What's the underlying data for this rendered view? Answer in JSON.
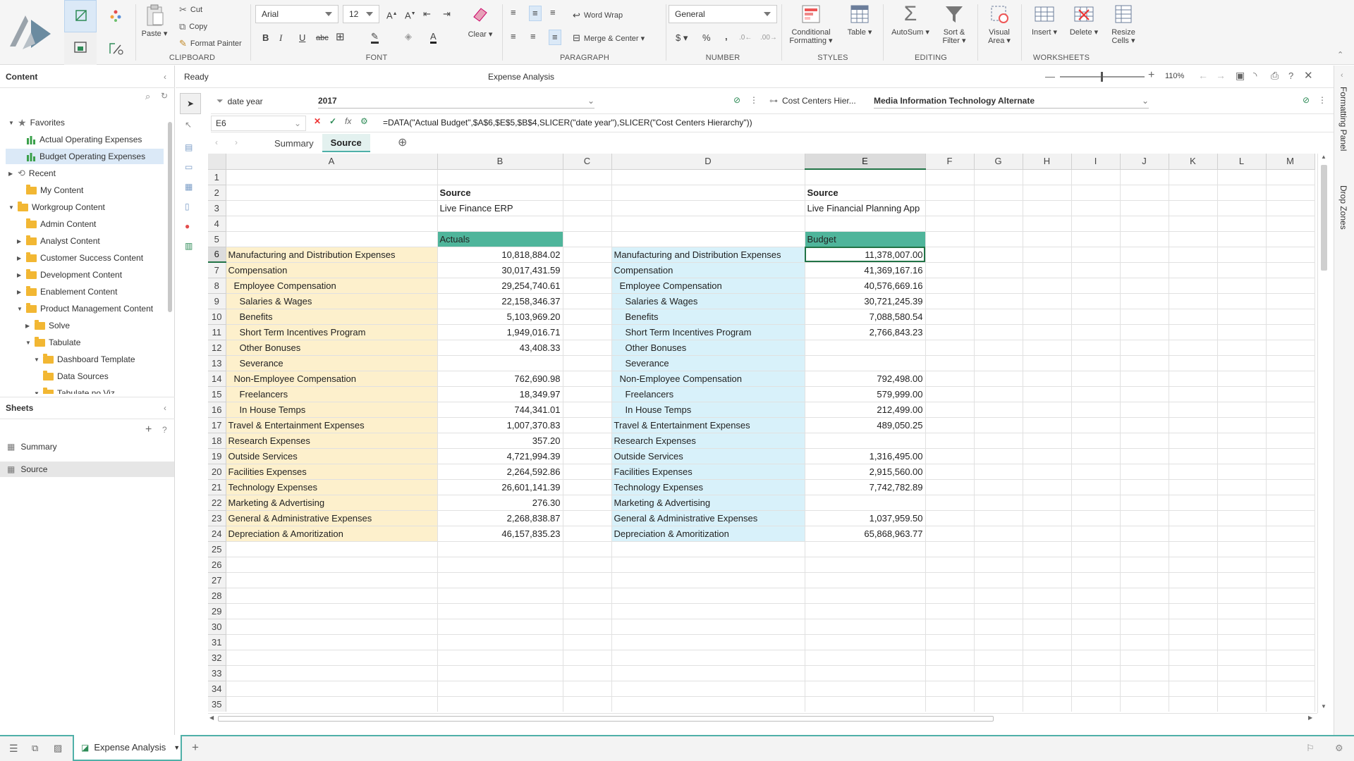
{
  "ribbon": {
    "clipboard": {
      "group": "Clipboard",
      "paste": "Paste ▾",
      "cut": "Cut",
      "copy": "Copy",
      "format_painter": "Format Painter"
    },
    "font": {
      "group": "Font",
      "name": "Arial",
      "size": "12"
    },
    "paragraph": {
      "group": "Paragraph",
      "word_wrap": "Word Wrap",
      "merge_center": "Merge & Center ▾"
    },
    "number": {
      "group": "Number",
      "format": "General"
    },
    "clear": "Clear ▾",
    "styles": {
      "group": "Styles",
      "conditional": "Conditional\nFormatting ▾",
      "table": "Table ▾"
    },
    "editing": {
      "group": "Editing",
      "autosum": "AutoSum ▾",
      "sort": "Sort &\nFilter ▾"
    },
    "visual_area": "Visual\nArea ▾",
    "worksheets": {
      "group": "Worksheets",
      "insert": "Insert ▾",
      "delete": "Delete ▾",
      "resize": "Resize\nCells ▾"
    }
  },
  "content_panel": {
    "title": "Content",
    "items": [
      {
        "label": "Favorites",
        "level": 0,
        "icon": "star",
        "twisty": "▼"
      },
      {
        "label": "Actual Operating Expenses",
        "level": 1,
        "icon": "chart",
        "twisty": ""
      },
      {
        "label": "Budget Operating Expenses",
        "level": 1,
        "icon": "chart",
        "twisty": "",
        "selected": true
      },
      {
        "label": "Recent",
        "level": 0,
        "icon": "history",
        "twisty": "▶"
      },
      {
        "label": "My Content",
        "level": 1,
        "icon": "folder",
        "twisty": ""
      },
      {
        "label": "Workgroup Content",
        "level": 0,
        "icon": "folder-group",
        "twisty": "▼"
      },
      {
        "label": "Admin Content",
        "level": 1,
        "icon": "folder",
        "twisty": ""
      },
      {
        "label": "Analyst Content",
        "level": 1,
        "icon": "folder",
        "twisty": "▶"
      },
      {
        "label": "Customer Success Content",
        "level": 1,
        "icon": "folder",
        "twisty": "▶"
      },
      {
        "label": "Development Content",
        "level": 1,
        "icon": "folder",
        "twisty": "▶"
      },
      {
        "label": "Enablement Content",
        "level": 1,
        "icon": "folder",
        "twisty": "▶"
      },
      {
        "label": "Product Management Content",
        "level": 1,
        "icon": "folder",
        "twisty": "▼"
      },
      {
        "label": "Solve",
        "level": 2,
        "icon": "folder",
        "twisty": "▶"
      },
      {
        "label": "Tabulate",
        "level": 2,
        "icon": "folder",
        "twisty": "▼"
      },
      {
        "label": "Dashboard Template",
        "level": 3,
        "icon": "folder",
        "twisty": "▼"
      },
      {
        "label": "Data Sources",
        "level": 3,
        "icon": "folder",
        "twisty": ""
      },
      {
        "label": "Tabulate no Viz",
        "level": 3,
        "icon": "folder",
        "twisty": "▼"
      }
    ]
  },
  "sheets_panel": {
    "title": "Sheets",
    "items": [
      {
        "label": "Summary",
        "selected": false
      },
      {
        "label": "Source",
        "selected": true
      }
    ]
  },
  "title_bar": {
    "status": "Ready",
    "doc_title": "Expense Analysis",
    "zoom": "110%"
  },
  "slicers": [
    {
      "label": "date year",
      "value": "2017"
    },
    {
      "label": "Cost Centers Hier...",
      "value": "Media Information Technology Alternate"
    }
  ],
  "formula": {
    "cell_ref": "E6",
    "text": "=DATA(\"Actual Budget\",$A$6,$E$5,$B$4,SLICER(\"date year\"),SLICER(\"Cost Centers Hierarchy\"))"
  },
  "sheet_tabs": [
    {
      "label": "Summary",
      "active": false
    },
    {
      "label": "Source",
      "active": true
    }
  ],
  "grid": {
    "columns": [
      "A",
      "B",
      "C",
      "D",
      "E",
      "F",
      "G",
      "H",
      "I",
      "J",
      "K",
      "L",
      "M"
    ],
    "selected_col": "E",
    "selected_row": "6",
    "rows": [
      {
        "n": "1",
        "a": "",
        "b": "",
        "d": "",
        "e": ""
      },
      {
        "n": "2",
        "a": "",
        "b": "Source",
        "d": "",
        "e": "Source"
      },
      {
        "n": "3",
        "a": "",
        "b": "Live Finance ERP",
        "d": "",
        "e": "Live Financial Planning App"
      },
      {
        "n": "4",
        "a": "",
        "b": "",
        "d": "",
        "e": ""
      },
      {
        "n": "5",
        "a": "",
        "b": "Actuals",
        "d": "",
        "e": "Budget"
      },
      {
        "n": "6",
        "a": "Manufacturing and Distribution Expenses",
        "b": "10,818,884.02",
        "d": "Manufacturing and Distribution Expenses",
        "e": "11,378,007.00",
        "ind": 0
      },
      {
        "n": "7",
        "a": "Compensation",
        "b": "30,017,431.59",
        "d": "Compensation",
        "e": "41,369,167.16",
        "ind": 0
      },
      {
        "n": "8",
        "a": "Employee Compensation",
        "b": "29,254,740.61",
        "d": "Employee Compensation",
        "e": "40,576,669.16",
        "ind": 1
      },
      {
        "n": "9",
        "a": "Salaries & Wages",
        "b": "22,158,346.37",
        "d": "Salaries & Wages",
        "e": "30,721,245.39",
        "ind": 2
      },
      {
        "n": "10",
        "a": "Benefits",
        "b": "5,103,969.20",
        "d": "Benefits",
        "e": "7,088,580.54",
        "ind": 2
      },
      {
        "n": "11",
        "a": "Short Term Incentives Program",
        "b": "1,949,016.71",
        "d": "Short Term Incentives Program",
        "e": "2,766,843.23",
        "ind": 2
      },
      {
        "n": "12",
        "a": "Other Bonuses",
        "b": "43,408.33",
        "d": "Other Bonuses",
        "e": "",
        "ind": 2
      },
      {
        "n": "13",
        "a": "Severance",
        "b": "",
        "d": "Severance",
        "e": "",
        "ind": 2
      },
      {
        "n": "14",
        "a": "Non-Employee Compensation",
        "b": "762,690.98",
        "d": "Non-Employee Compensation",
        "e": "792,498.00",
        "ind": 1
      },
      {
        "n": "15",
        "a": "Freelancers",
        "b": "18,349.97",
        "d": "Freelancers",
        "e": "579,999.00",
        "ind": 2
      },
      {
        "n": "16",
        "a": "In House Temps",
        "b": "744,341.01",
        "d": "In House Temps",
        "e": "212,499.00",
        "ind": 2
      },
      {
        "n": "17",
        "a": "Travel & Entertainment Expenses",
        "b": "1,007,370.83",
        "d": "Travel & Entertainment Expenses",
        "e": "489,050.25",
        "ind": 0
      },
      {
        "n": "18",
        "a": "Research Expenses",
        "b": "357.20",
        "d": "Research Expenses",
        "e": "",
        "ind": 0
      },
      {
        "n": "19",
        "a": "Outside Services",
        "b": "4,721,994.39",
        "d": "Outside Services",
        "e": "1,316,495.00",
        "ind": 0
      },
      {
        "n": "20",
        "a": "Facilities Expenses",
        "b": "2,264,592.86",
        "d": "Facilities Expenses",
        "e": "2,915,560.00",
        "ind": 0
      },
      {
        "n": "21",
        "a": "Technology Expenses",
        "b": "26,601,141.39",
        "d": "Technology Expenses",
        "e": "7,742,782.89",
        "ind": 0
      },
      {
        "n": "22",
        "a": "Marketing & Advertising",
        "b": "276.30",
        "d": "Marketing & Advertising",
        "e": "",
        "ind": 0
      },
      {
        "n": "23",
        "a": "General & Administrative Expenses",
        "b": "2,268,838.87",
        "d": "General & Administrative Expenses",
        "e": "1,037,959.50",
        "ind": 0
      },
      {
        "n": "24",
        "a": "Depreciation & Amoritization",
        "b": "46,157,835.23",
        "d": "Depreciation & Amoritization",
        "e": "65,868,963.77",
        "ind": 0
      },
      {
        "n": "25"
      },
      {
        "n": "26"
      },
      {
        "n": "27"
      },
      {
        "n": "28"
      },
      {
        "n": "29"
      },
      {
        "n": "30"
      },
      {
        "n": "31"
      },
      {
        "n": "32"
      },
      {
        "n": "33"
      },
      {
        "n": "34"
      },
      {
        "n": "35"
      }
    ]
  },
  "right_panel": {
    "formatting": "Formatting Panel",
    "drop_zones": "Drop Zones"
  },
  "bottom": {
    "workbook_tab": "Expense Analysis"
  },
  "colors": {
    "accent": "#217346",
    "actuals_header": "#4fb59b",
    "actuals_fill": "#fdf0cc",
    "budget_fill": "#d8f1fa",
    "teal": "#4fb0a8"
  }
}
